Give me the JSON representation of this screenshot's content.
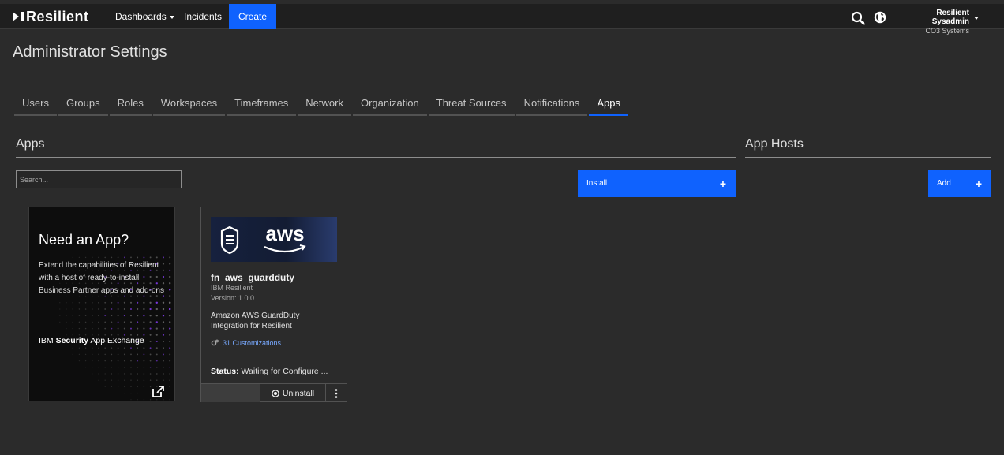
{
  "app": {
    "logo_text": "Resilient",
    "nav": {
      "dashboards": "Dashboards",
      "incidents": "Incidents",
      "create": "Create"
    },
    "icons": [
      "search-icon",
      "globe-icon",
      "chevron-down-icon"
    ],
    "user": {
      "name": "Resilient Sysadmin",
      "org": "CO3 Systems"
    }
  },
  "page": {
    "title": "Administrator Settings"
  },
  "tabs": [
    {
      "label": "Users",
      "active": false
    },
    {
      "label": "Groups",
      "active": false
    },
    {
      "label": "Roles",
      "active": false
    },
    {
      "label": "Workspaces",
      "active": false
    },
    {
      "label": "Timeframes",
      "active": false
    },
    {
      "label": "Network",
      "active": false
    },
    {
      "label": "Organization",
      "active": false
    },
    {
      "label": "Threat Sources",
      "active": false
    },
    {
      "label": "Notifications",
      "active": false
    },
    {
      "label": "Apps",
      "active": true
    }
  ],
  "apps_section": {
    "title": "Apps",
    "search_placeholder": "Search...",
    "install_label": "Install",
    "install_icon": "plus-icon"
  },
  "hosts_section": {
    "title": "App Hosts",
    "add_label": "Add",
    "add_icon": "plus-icon"
  },
  "promo": {
    "heading": "Need an App?",
    "description": "Extend the capabilities of Resilient with a host of ready-to-install Business Partner apps and add-ons",
    "exchange_prefix": "IBM ",
    "exchange_bold": "Security",
    "exchange_suffix": " App Exchange",
    "icon": "external-link-icon"
  },
  "app_cards": [
    {
      "banner_text": "aws",
      "name": "fn_aws_guardduty",
      "vendor": "IBM Resilient",
      "version": "Version: 1.0.0",
      "description": "Amazon AWS GuardDuty Integration for Resilient",
      "customizations": "31 Customizations",
      "status_label": "Status:",
      "status_value": "Waiting for Configure ...",
      "uninstall_label": "Uninstall"
    }
  ],
  "colors": {
    "accent": "#0f62fe",
    "background": "#2b2b2b",
    "topbar": "#1f1f1f",
    "link": "#78a9ff"
  }
}
